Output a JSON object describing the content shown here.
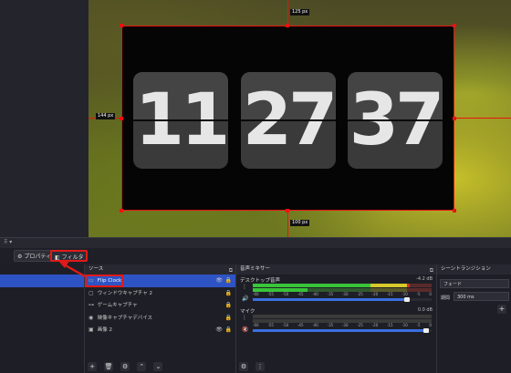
{
  "preview": {
    "clock": {
      "hour": "11",
      "minute": "27",
      "second": "37"
    },
    "dims": {
      "top": "125 px",
      "left": "144 px",
      "bottom": "100 px"
    }
  },
  "toolbar": {
    "properties_label": "プロパティ",
    "filters_label": "フィルタ"
  },
  "sources": {
    "title": "ソース",
    "items": [
      {
        "label": "Flip Clock",
        "icon": "display-icon"
      },
      {
        "label": "ウィンドウキャプチャ 2",
        "icon": "window-icon"
      },
      {
        "label": "ゲームキャプチャ",
        "icon": "gamepad-icon"
      },
      {
        "label": "映像キャプチャデバイス",
        "icon": "camera-icon"
      },
      {
        "label": "画像 2",
        "icon": "image-icon"
      }
    ]
  },
  "mixer": {
    "title": "音声ミキサー",
    "channels": [
      {
        "name": "デスクトップ音声",
        "db": "-4.2 dB",
        "level": 0.88,
        "volume": 0.86
      },
      {
        "name": "マイク",
        "db": "0.0 dB",
        "level": 0.0,
        "volume": 0.97
      }
    ],
    "scale": [
      "-60",
      "-55",
      "-50",
      "-45",
      "-40",
      "-35",
      "-30",
      "-25",
      "-20",
      "-15",
      "-10",
      "-5",
      "0"
    ]
  },
  "transitions": {
    "title": "シーントランジション",
    "type": "フェード",
    "duration_label": "期間",
    "duration_value": "300 ms"
  },
  "colors": {
    "accent_red": "#e01a1a",
    "selection_blue": "#2e53c4"
  }
}
